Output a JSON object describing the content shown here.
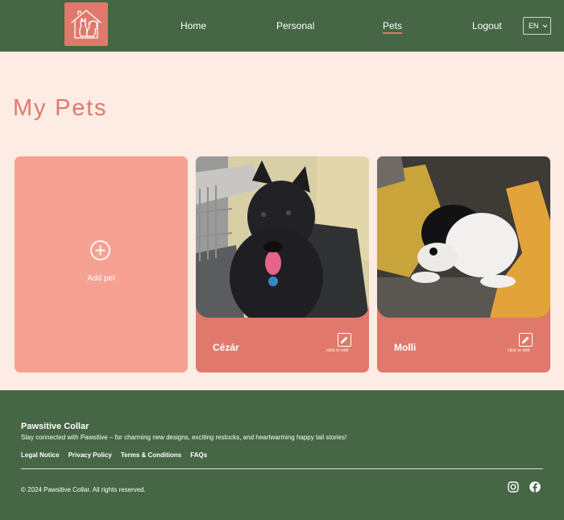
{
  "header": {
    "nav": {
      "home": "Home",
      "personal": "Personal",
      "pets": "Pets",
      "logout": "Logout"
    },
    "language": "EN",
    "logo_icon": "home-dog-cat-icon"
  },
  "main": {
    "title": "My Pets",
    "add_pet_label": "Add pet",
    "pets": [
      {
        "name": "Cézár",
        "edit_hint": "click to edit"
      },
      {
        "name": "Molli",
        "edit_hint": "click to edit"
      }
    ]
  },
  "footer": {
    "brand": "Pawsitive Collar",
    "tagline": "Stay connected with Pawsitive – for charming new designs, exciting restocks, and heartwarming happy tail stories!",
    "links": [
      "Legal Notice",
      "Privacy Policy",
      "Terms & Conditions",
      "FAQs"
    ],
    "copyright": "© 2024 Pawsitive Collar. All rights reserved.",
    "social_icons": [
      "instagram-icon",
      "facebook-icon"
    ]
  },
  "colors": {
    "header_bg": "#466646",
    "accent": "#e0796b",
    "add_card": "#f6a192",
    "page_bg": "#fcece4"
  }
}
